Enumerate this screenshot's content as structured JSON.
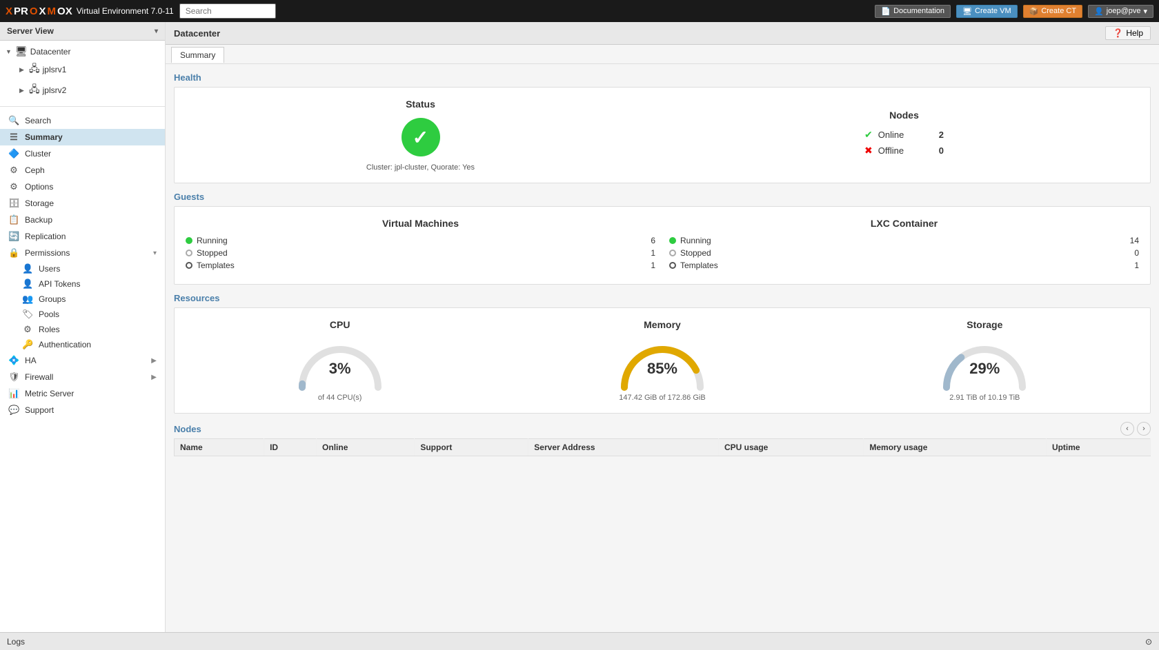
{
  "topbar": {
    "logo_text": "PROXMOX",
    "logo_version": "Virtual Environment 7.0-11",
    "search_placeholder": "Search",
    "doc_btn": "Documentation",
    "create_vm_btn": "Create VM",
    "create_ct_btn": "Create CT",
    "user": "joep@pve"
  },
  "sidebar": {
    "header_label": "Server View",
    "tree": {
      "datacenter": "Datacenter",
      "nodes": [
        "jplsrv1",
        "jplsrv2"
      ]
    },
    "nav": [
      {
        "id": "search",
        "label": "Search",
        "icon": "🔍"
      },
      {
        "id": "summary",
        "label": "Summary",
        "icon": "☰",
        "active": true
      },
      {
        "id": "cluster",
        "label": "Cluster",
        "icon": "🔷"
      },
      {
        "id": "ceph",
        "label": "Ceph",
        "icon": "⚙"
      },
      {
        "id": "options",
        "label": "Options",
        "icon": "⚙"
      },
      {
        "id": "storage",
        "label": "Storage",
        "icon": "🗄"
      },
      {
        "id": "backup",
        "label": "Backup",
        "icon": "📋"
      },
      {
        "id": "replication",
        "label": "Replication",
        "icon": "🔄"
      },
      {
        "id": "permissions",
        "label": "Permissions",
        "icon": "🔒",
        "expandable": true
      },
      {
        "id": "ha",
        "label": "HA",
        "icon": "💠",
        "expandable": true
      },
      {
        "id": "firewall",
        "label": "Firewall",
        "icon": "🛡",
        "expandable": true
      },
      {
        "id": "metric-server",
        "label": "Metric Server",
        "icon": "📊"
      },
      {
        "id": "support",
        "label": "Support",
        "icon": "💬"
      }
    ],
    "permissions_sub": [
      {
        "id": "users",
        "label": "Users",
        "icon": "👤"
      },
      {
        "id": "api-tokens",
        "label": "API Tokens",
        "icon": "👤"
      },
      {
        "id": "groups",
        "label": "Groups",
        "icon": "👥"
      },
      {
        "id": "pools",
        "label": "Pools",
        "icon": "🏷"
      },
      {
        "id": "roles",
        "label": "Roles",
        "icon": "⚙"
      },
      {
        "id": "authentication",
        "label": "Authentication",
        "icon": "🔑"
      }
    ]
  },
  "content": {
    "header": "Datacenter",
    "help_btn": "Help",
    "tab_active": "Summary",
    "tabs": [
      "Summary"
    ]
  },
  "health": {
    "section_title": "Health",
    "status_title": "Status",
    "cluster_info": "Cluster: jpl-cluster, Quorate: Yes",
    "nodes_title": "Nodes",
    "nodes": [
      {
        "label": "Online",
        "status": "online",
        "count": "2"
      },
      {
        "label": "Offline",
        "status": "offline",
        "count": "0"
      }
    ]
  },
  "guests": {
    "section_title": "Guests",
    "vm_title": "Virtual Machines",
    "lxc_title": "LXC Container",
    "vm_rows": [
      {
        "label": "Running",
        "count": "6",
        "type": "running"
      },
      {
        "label": "Stopped",
        "count": "1",
        "type": "stopped"
      },
      {
        "label": "Templates",
        "count": "1",
        "type": "template"
      }
    ],
    "lxc_rows": [
      {
        "label": "Running",
        "count": "14",
        "type": "running"
      },
      {
        "label": "Stopped",
        "count": "0",
        "type": "stopped"
      },
      {
        "label": "Templates",
        "count": "1",
        "type": "template"
      }
    ]
  },
  "resources": {
    "section_title": "Resources",
    "cpu": {
      "title": "CPU",
      "percent": "3%",
      "sub": "of 44 CPU(s)",
      "value": 3,
      "color": "#a0b8cc"
    },
    "memory": {
      "title": "Memory",
      "percent": "85%",
      "sub": "147.42 GiB of 172.86 GiB",
      "value": 85,
      "color": "#e0a800"
    },
    "storage": {
      "title": "Storage",
      "percent": "29%",
      "sub": "2.91 TiB of 10.19 TiB",
      "value": 29,
      "color": "#a0b8cc"
    }
  },
  "nodes_table": {
    "section_title": "Nodes",
    "columns": [
      "Name",
      "ID",
      "Online",
      "Support",
      "Server Address",
      "CPU usage",
      "Memory usage",
      "Uptime"
    ]
  },
  "bottom": {
    "logs_label": "Logs"
  }
}
